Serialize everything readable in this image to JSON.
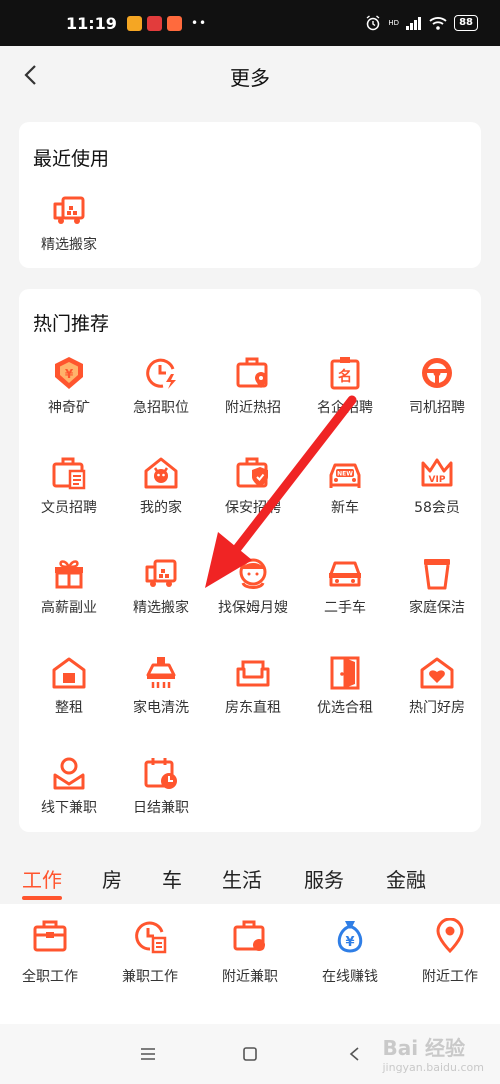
{
  "status_bar": {
    "time": "11:19",
    "battery": "88",
    "dots": "••",
    "hd": "HD"
  },
  "header": {
    "title": "更多"
  },
  "recent": {
    "title": "最近使用",
    "items": [
      {
        "label": "精选搬家",
        "icon": "moving-truck-icon"
      }
    ]
  },
  "hot": {
    "title": "热门推荐",
    "items": [
      {
        "label": "神奇矿",
        "icon": "yuan-shield-icon"
      },
      {
        "label": "急招职位",
        "icon": "clock-flash-icon"
      },
      {
        "label": "附近热招",
        "icon": "briefcase-pin-icon"
      },
      {
        "label": "名企招聘",
        "icon": "badge-name-icon"
      },
      {
        "label": "司机招聘",
        "icon": "steering-wheel-icon"
      },
      {
        "label": "文员招聘",
        "icon": "briefcase-doc-icon"
      },
      {
        "label": "我的家",
        "icon": "home-face-icon"
      },
      {
        "label": "保安招聘",
        "icon": "briefcase-shield-icon"
      },
      {
        "label": "新车",
        "icon": "new-car-icon"
      },
      {
        "label": "58会员",
        "icon": "vip-crown-icon"
      },
      {
        "label": "高薪副业",
        "icon": "gift-icon"
      },
      {
        "label": "精选搬家",
        "icon": "moving-truck-icon"
      },
      {
        "label": "找保姆月嫂",
        "icon": "nanny-icon"
      },
      {
        "label": "二手车",
        "icon": "used-car-icon"
      },
      {
        "label": "家庭保洁",
        "icon": "cleaning-bucket-icon"
      },
      {
        "label": "整租",
        "icon": "house-icon"
      },
      {
        "label": "家电清洗",
        "icon": "range-hood-icon"
      },
      {
        "label": "房东直租",
        "icon": "sofa-icon"
      },
      {
        "label": "优选合租",
        "icon": "door-icon"
      },
      {
        "label": "热门好房",
        "icon": "house-heart-icon"
      },
      {
        "label": "线下兼职",
        "icon": "person-mail-icon"
      },
      {
        "label": "日结兼职",
        "icon": "calendar-clock-icon"
      }
    ]
  },
  "tabs": [
    {
      "label": "工作",
      "active": true
    },
    {
      "label": "房",
      "active": false
    },
    {
      "label": "车",
      "active": false
    },
    {
      "label": "生活",
      "active": false
    },
    {
      "label": "服务",
      "active": false
    },
    {
      "label": "金融",
      "active": false
    }
  ],
  "work_items": [
    {
      "label": "全职工作",
      "icon": "briefcase-icon"
    },
    {
      "label": "兼职工作",
      "icon": "clock-doc-icon"
    },
    {
      "label": "附近兼职",
      "icon": "briefcase-dot-icon"
    },
    {
      "label": "在线赚钱",
      "icon": "money-bag-icon"
    },
    {
      "label": "附近工作",
      "icon": "location-pin-icon"
    }
  ],
  "watermark": {
    "main": "Bai 经验",
    "sub": "jingyan.baidu.com"
  },
  "colors": {
    "accent": "#ff552e",
    "money_blue": "#2f7ee6",
    "background": "#f4f4f4"
  }
}
